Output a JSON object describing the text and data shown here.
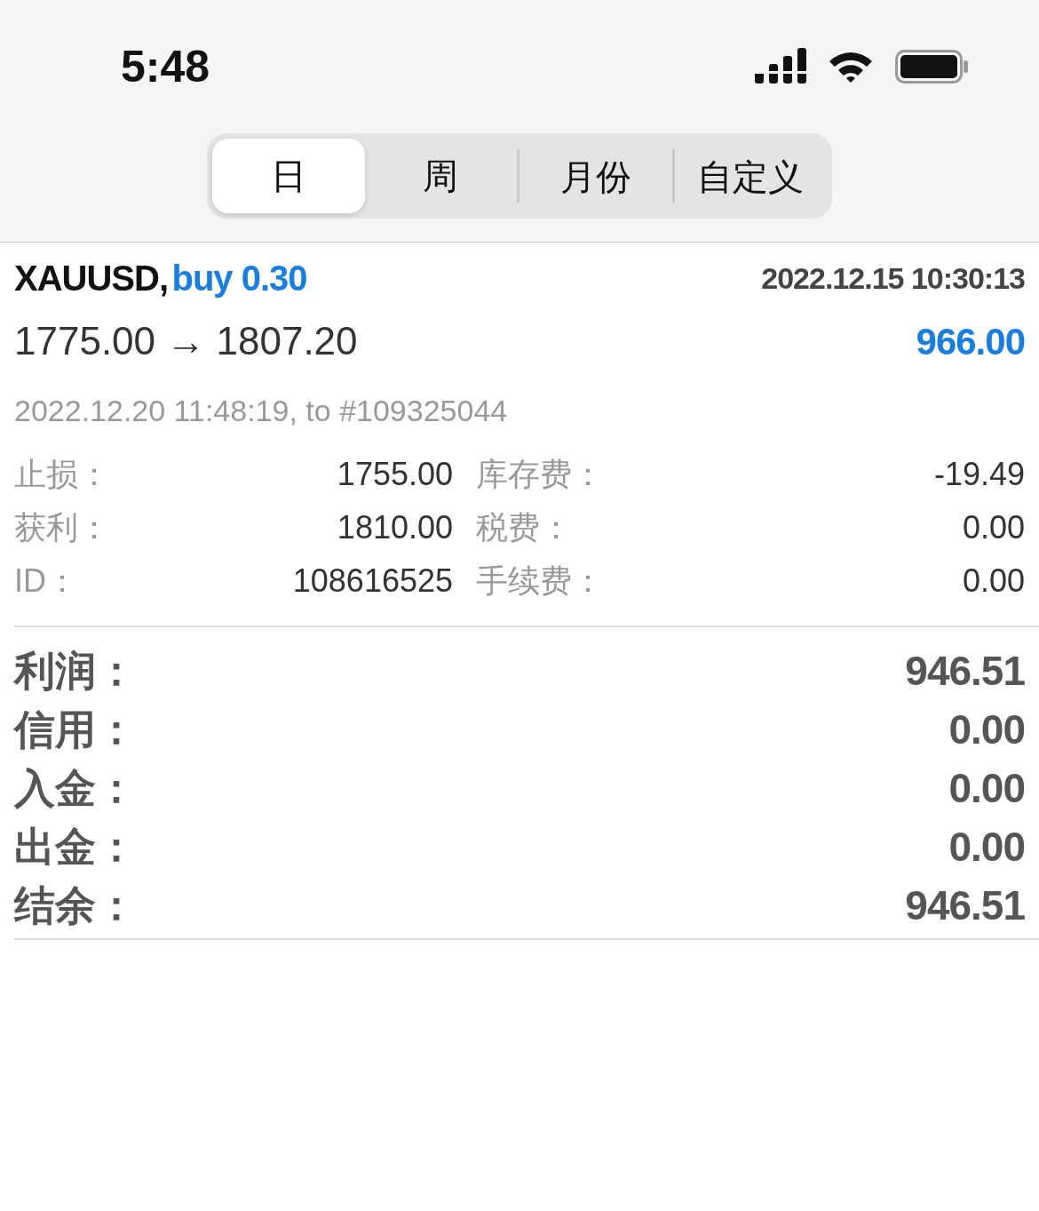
{
  "status_bar": {
    "time": "5:48"
  },
  "period_tabs": [
    {
      "label": "日",
      "selected": true
    },
    {
      "label": "周",
      "selected": false
    },
    {
      "label": "月份",
      "selected": false
    },
    {
      "label": "自定义",
      "selected": false
    }
  ],
  "trade": {
    "symbol": "XAUUSD,",
    "side": "buy 0.30",
    "open_time": "2022.12.15 10:30:13",
    "price_move": "1775.00 → 1807.20",
    "profit": "966.00",
    "close_info": "2022.12.20 11:48:19, to #109325044",
    "details": [
      {
        "label": "止损：",
        "value": "1755.00"
      },
      {
        "label": "库存费：",
        "value": "-19.49"
      },
      {
        "label": "获利：",
        "value": "1810.00"
      },
      {
        "label": "税费：",
        "value": "0.00"
      },
      {
        "label": "ID：",
        "value": "108616525"
      },
      {
        "label": "手续费：",
        "value": "0.00"
      }
    ]
  },
  "summary": [
    {
      "label": "利润：",
      "value": "946.51"
    },
    {
      "label": "信用：",
      "value": "0.00"
    },
    {
      "label": "入金：",
      "value": "0.00"
    },
    {
      "label": "出金：",
      "value": "0.00"
    },
    {
      "label": "结余：",
      "value": "946.51"
    }
  ]
}
